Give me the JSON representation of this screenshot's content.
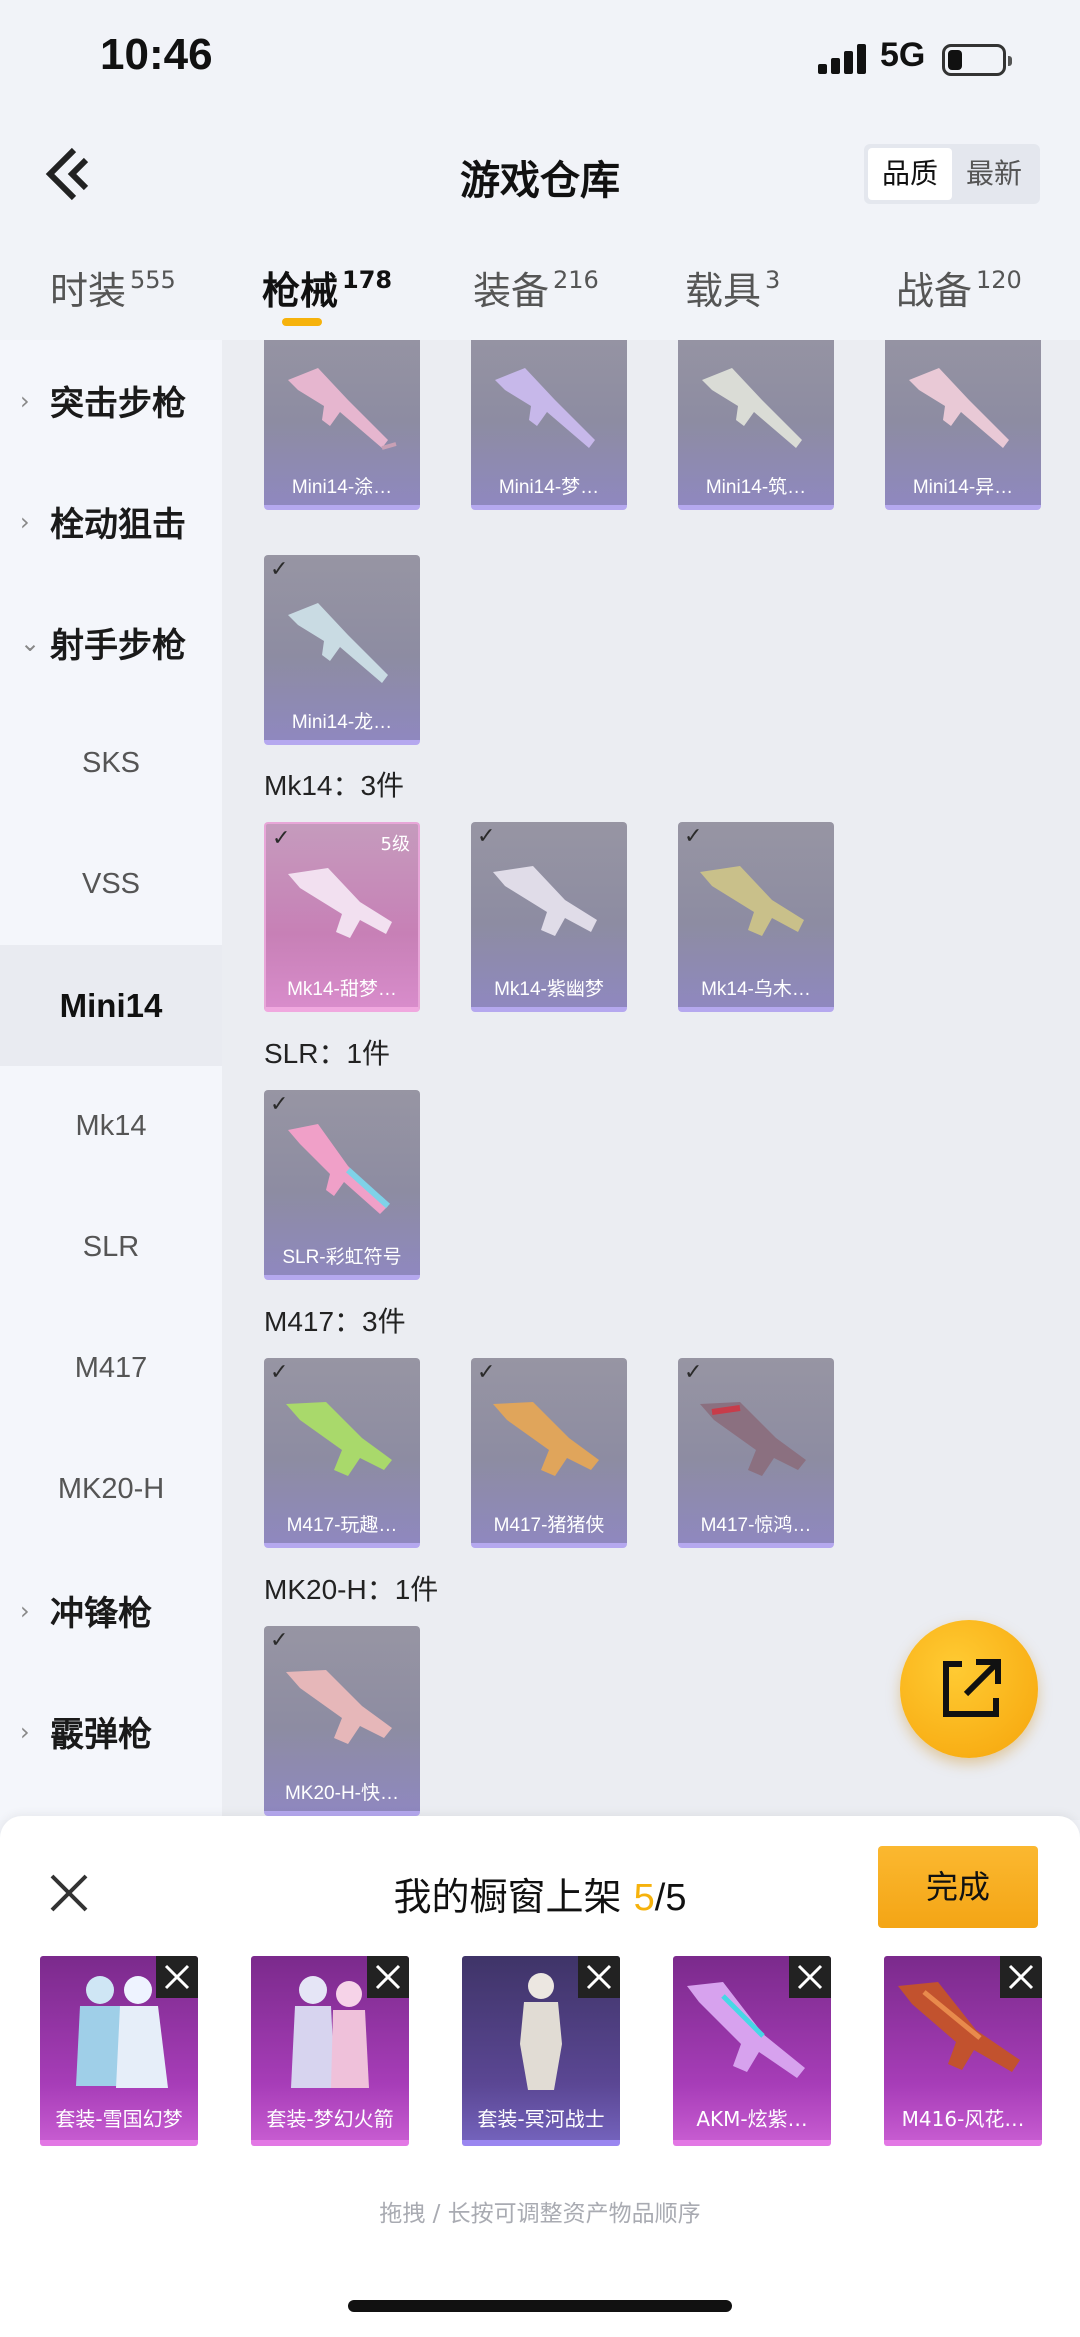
{
  "status_bar": {
    "time": "10:46",
    "network": "5G"
  },
  "header": {
    "title": "游戏仓库",
    "sort_options": [
      "品质",
      "最新"
    ],
    "active_sort": "品质"
  },
  "tabs": [
    {
      "label": "时装",
      "count": "555"
    },
    {
      "label": "枪械",
      "count": "178",
      "active": true
    },
    {
      "label": "装备",
      "count": "216"
    },
    {
      "label": "载具",
      "count": "3"
    },
    {
      "label": "战备",
      "count": "120"
    }
  ],
  "sidebar": {
    "items": [
      {
        "label": "突击步枪",
        "type": "category",
        "expanded": false
      },
      {
        "label": "栓动狙击",
        "type": "category",
        "expanded": false
      },
      {
        "label": "射手步枪",
        "type": "category",
        "expanded": true
      },
      {
        "label": "SKS",
        "type": "sub"
      },
      {
        "label": "VSS",
        "type": "sub"
      },
      {
        "label": "Mini14",
        "type": "sub",
        "active": true
      },
      {
        "label": "Mk14",
        "type": "sub"
      },
      {
        "label": "SLR",
        "type": "sub"
      },
      {
        "label": "M417",
        "type": "sub"
      },
      {
        "label": "MK20-H",
        "type": "sub"
      },
      {
        "label": "冲锋枪",
        "type": "category",
        "expanded": false
      },
      {
        "label": "霰弹枪",
        "type": "category",
        "expanded": false
      }
    ]
  },
  "content": {
    "mini14_row1": [
      "Mini14-涂…",
      "Mini14-梦…",
      "Mini14-筑…",
      "Mini14-异…"
    ],
    "mini14_row2": [
      "Mini14-龙…"
    ],
    "groups": [
      {
        "title": "Mk14：3件",
        "items": [
          {
            "label": "Mk14-甜梦…",
            "level": "5级",
            "quality": "pink"
          },
          {
            "label": "Mk14-紫幽梦"
          },
          {
            "label": "Mk14-乌木…"
          }
        ]
      },
      {
        "title": "SLR：1件",
        "items": [
          {
            "label": "SLR-彩虹符号"
          }
        ]
      },
      {
        "title": "M417：3件",
        "items": [
          {
            "label": "M417-玩趣…"
          },
          {
            "label": "M417-猪猪侠"
          },
          {
            "label": "M417-惊鸿…"
          }
        ]
      },
      {
        "title": "MK20-H：1件",
        "items": [
          {
            "label": "MK20-H-快…"
          }
        ]
      }
    ]
  },
  "shelf": {
    "title_prefix": "我的橱窗上架 ",
    "current": "5",
    "total": "/5",
    "done_label": "完成",
    "items": [
      "套装-雪国幻梦",
      "套装-梦幻火箭",
      "套装-冥河战士",
      "AKM-炫紫…",
      "M416-风花…"
    ],
    "hint": "拖拽 / 长按可调整资产物品顺序"
  },
  "colors": {
    "accent": "#f6b20c",
    "card_purple": "#8d8ca2",
    "card_pink": "#c780b6"
  }
}
